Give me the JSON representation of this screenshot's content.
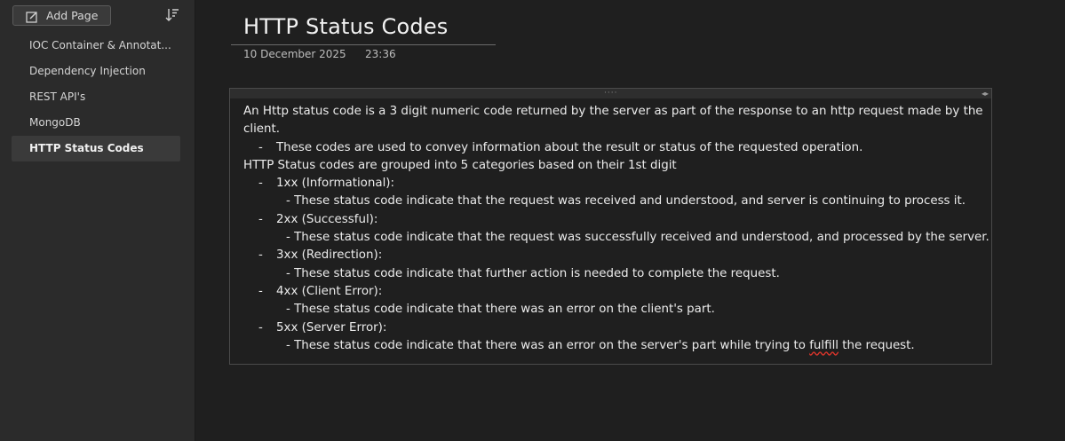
{
  "sidebar": {
    "add_page_label": "Add Page",
    "items": [
      {
        "label": "IOC Container &  Annotat...",
        "active": false
      },
      {
        "label": "Dependency Injection",
        "active": false
      },
      {
        "label": "REST API's",
        "active": false
      },
      {
        "label": "MongoDB",
        "active": false
      },
      {
        "label": "HTTP Status Codes",
        "active": true
      }
    ]
  },
  "page": {
    "title": "HTTP Status  Codes",
    "date": "10 December 2025",
    "time": "23:36"
  },
  "note": {
    "intro": "An Http status code is a 3 digit numeric code returned by the server as part of the response to an http request made by the",
    "intro_cont": "client.",
    "intro_bullet": "These codes are used to convey information about the result or status of the requested operation.",
    "groups_heading": "HTTP Status codes are grouped into 5 categories based on their 1st digit",
    "categories": [
      {
        "name": "1xx (Informational):",
        "desc": "- These status code indicate that the request was received and understood,  and server is continuing to  process it."
      },
      {
        "name": "2xx (Successful):",
        "desc": "- These status code indicate that the request was successfully received and understood,  and processed by the server."
      },
      {
        "name": "3xx (Redirection):",
        "desc": "- These status code indicate that further action is needed to complete the request."
      },
      {
        "name": "4xx (Client Error):",
        "desc": "- These status code indicate that there was an error on the client's part."
      },
      {
        "name": "5xx (Server Error):",
        "desc_before": "- These status code indicate that there was an error on the server's part while trying to ",
        "desc_misspelled": "fulfill",
        "desc_after": " the request."
      }
    ],
    "dash": "-"
  }
}
